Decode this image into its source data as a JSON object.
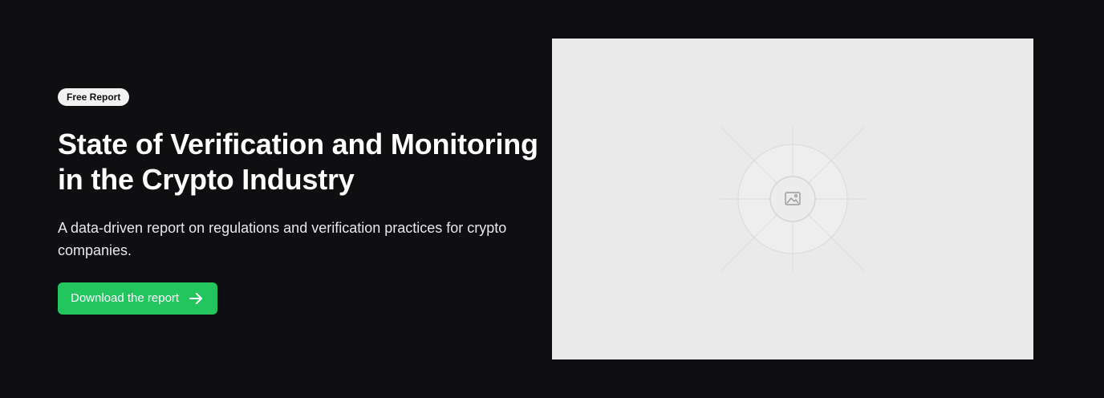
{
  "hero": {
    "badge": "Free Report",
    "title": "State of Verification and Monitoring in the Crypto Industry",
    "description": "A data-driven report on regulations and verification practices for crypto companies.",
    "cta_label": "Download the report"
  },
  "icons": {
    "cta": "arrow-right-icon",
    "media": "image-placeholder-icon"
  },
  "colors": {
    "background": "#0f0f12",
    "accent": "#22c55e",
    "media_background": "#eaeaea"
  }
}
